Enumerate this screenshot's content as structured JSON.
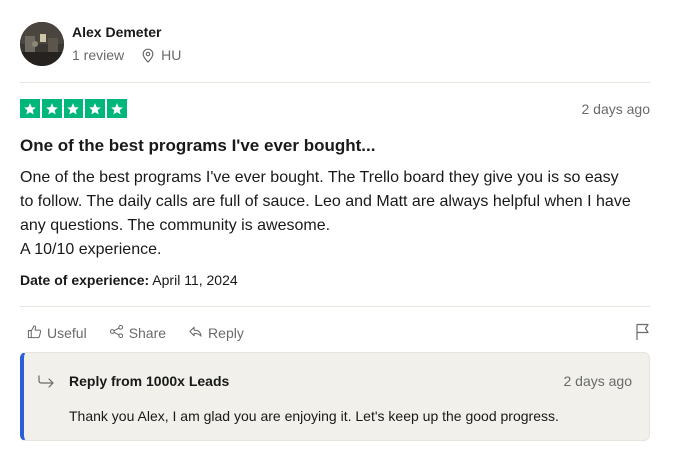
{
  "author": {
    "name": "Alex Demeter",
    "reviews": "1 review",
    "country": "HU",
    "avatar_icon": "profile-photo"
  },
  "review": {
    "rating": 5,
    "rating_max": 5,
    "star_color": "#00b67a",
    "date_ago": "2 days ago",
    "title": "One of the best programs I've ever bought...",
    "body_lines": [
      "One of the best programs I've ever bought. The Trello board they give you is so easy",
      "to follow. The daily calls are full of sauce. Leo and Matt are always helpful when I have",
      "any questions. The community is awesome.",
      "A 10/10 experience."
    ],
    "date_of_experience_label": "Date of experience:",
    "date_of_experience": "April 11, 2024"
  },
  "actions": {
    "useful": "Useful",
    "share": "Share",
    "reply": "Reply"
  },
  "company_reply": {
    "from": "Reply from 1000x Leads",
    "date_ago": "2 days ago",
    "text": "Thank you Alex, I am glad you are enjoying it. Let's keep up the good progress.",
    "accent_color": "#2c5fd6"
  }
}
